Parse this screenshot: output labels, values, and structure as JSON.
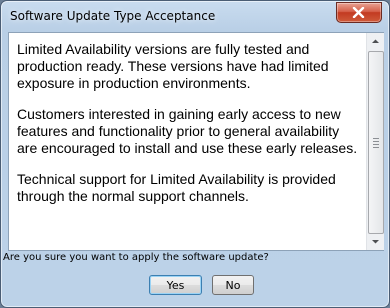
{
  "window": {
    "title": "Software Update Type Acceptance"
  },
  "message": {
    "paragraphs": [
      "Limited Availability versions are fully tested and production ready. These versions have had limited exposure in production environments.",
      "Customers interested in gaining early access to new features and functionality prior to general availability are encouraged to install and use these early releases.",
      "Technical support for Limited Availability is provided through the normal support channels."
    ]
  },
  "prompt": {
    "question": "Are you sure you want to apply the software update?"
  },
  "buttons": {
    "yes": "Yes",
    "no": "No"
  },
  "icons": {
    "close": "close-icon",
    "scroll_up": "chevron-up-icon",
    "scroll_down": "chevron-down-icon"
  },
  "colors": {
    "close_button": "#c23a21",
    "title_bar": "#c9dcef",
    "default_button_border": "#3c7fb1"
  }
}
